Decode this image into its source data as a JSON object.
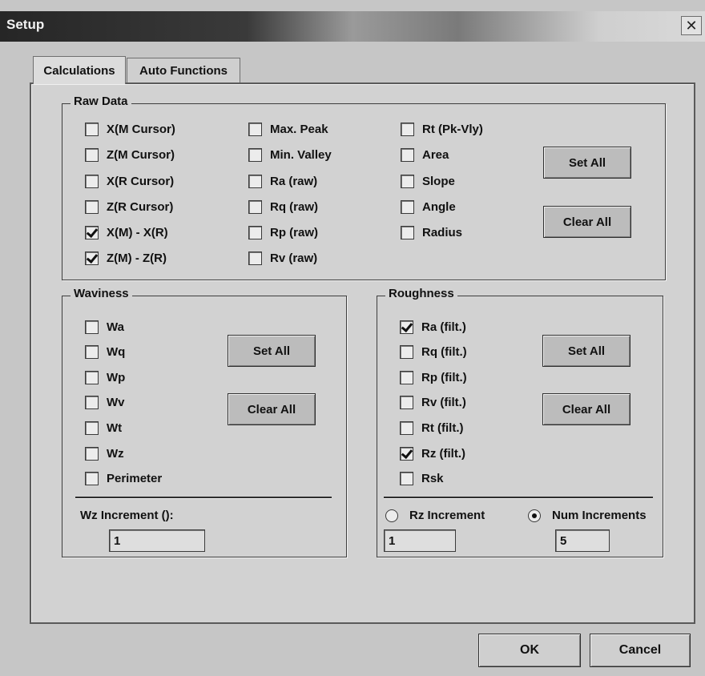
{
  "window": {
    "title": "Setup",
    "close_glyph": "✕"
  },
  "tabs": [
    {
      "label": "Calculations",
      "active": true
    },
    {
      "label": "Auto Functions",
      "active": false
    }
  ],
  "raw_data": {
    "legend": "Raw Data",
    "col1": [
      {
        "label": "X(M Cursor)",
        "checked": false
      },
      {
        "label": "Z(M Cursor)",
        "checked": false
      },
      {
        "label": "X(R Cursor)",
        "checked": false
      },
      {
        "label": "Z(R Cursor)",
        "checked": false
      },
      {
        "label": "X(M) - X(R)",
        "checked": true
      },
      {
        "label": "Z(M) - Z(R)",
        "checked": true
      }
    ],
    "col2": [
      {
        "label": "Max. Peak",
        "checked": false
      },
      {
        "label": "Min. Valley",
        "checked": false
      },
      {
        "label": "Ra (raw)",
        "checked": false
      },
      {
        "label": "Rq (raw)",
        "checked": false
      },
      {
        "label": "Rp (raw)",
        "checked": false
      },
      {
        "label": "Rv (raw)",
        "checked": false
      }
    ],
    "col3": [
      {
        "label": "Rt (Pk-Vly)",
        "checked": false
      },
      {
        "label": "Area",
        "checked": false
      },
      {
        "label": "Slope",
        "checked": false
      },
      {
        "label": "Angle",
        "checked": false
      },
      {
        "label": "Radius",
        "checked": false
      }
    ],
    "set_all": "Set All",
    "clear_all": "Clear All"
  },
  "waviness": {
    "legend": "Waviness",
    "items": [
      {
        "label": "Wa",
        "checked": false
      },
      {
        "label": "Wq",
        "checked": false
      },
      {
        "label": "Wp",
        "checked": false
      },
      {
        "label": "Wv",
        "checked": false
      },
      {
        "label": "Wt",
        "checked": false
      },
      {
        "label": "Wz",
        "checked": false
      },
      {
        "label": "Perimeter",
        "checked": false
      }
    ],
    "set_all": "Set All",
    "clear_all": "Clear All",
    "increment_label": "Wz Increment ():",
    "increment_value": "1"
  },
  "roughness": {
    "legend": "Roughness",
    "items": [
      {
        "label": "Ra (filt.)",
        "checked": true
      },
      {
        "label": "Rq (filt.)",
        "checked": false
      },
      {
        "label": "Rp (filt.)",
        "checked": false
      },
      {
        "label": "Rv (filt.)",
        "checked": false
      },
      {
        "label": "Rt (filt.)",
        "checked": false
      },
      {
        "label": "Rz (filt.)",
        "checked": true
      },
      {
        "label": "Rsk",
        "checked": false
      }
    ],
    "set_all": "Set All",
    "clear_all": "Clear All",
    "radio_rz_label": "Rz Increment",
    "radio_num_label": "Num Increments",
    "selected_radio": "num",
    "rz_increment_value": "1",
    "num_increments_value": "5"
  },
  "footer": {
    "ok": "OK",
    "cancel": "Cancel"
  }
}
